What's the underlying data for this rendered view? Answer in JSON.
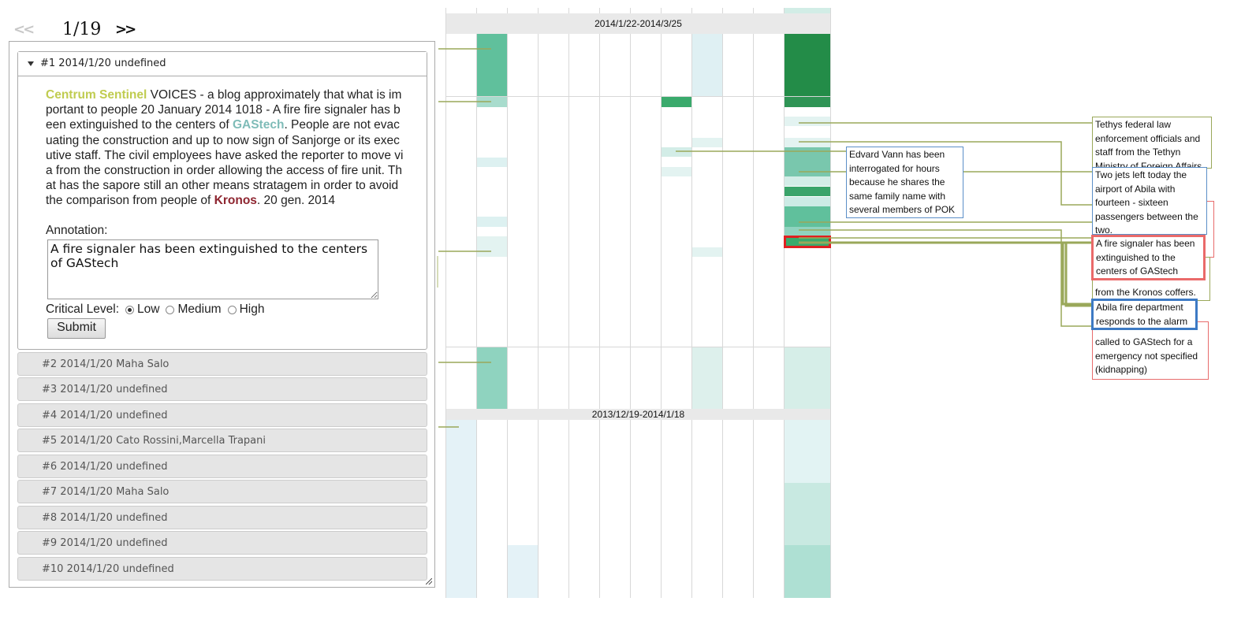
{
  "pager": {
    "prev_label": "<<",
    "text": "1/19",
    "next_label": ">>"
  },
  "current_article": {
    "header": "#1 2014/1/20 undefined",
    "source": "Centrum Sentinel",
    "text_1": " VOICES - a blog approximately that what is important to people 20 January 2014 1018 - A fire fire signaler has been extinguished to the centers of ",
    "entity_2": "GAStech",
    "text_2": ". People are not evacuating the construction and up to now sign of Sanjorge or its executive staff. The civil employees have asked the reporter to move via from the construction in order allowing the access of fire unit. That has the sapore still an other means stratagem in order to avoid the comparison from people of ",
    "entity_3": "Kronos",
    "text_3": ". 20 gen. 2014",
    "annotation_label": "Annotation:",
    "annotation_value": "A fire signaler has been extinguished to the centers of GAStech",
    "critical_label": "Critical Level:",
    "levels": [
      "Low",
      "Medium",
      "High"
    ],
    "selected_level": "Low",
    "submit_label": "Submit"
  },
  "articles": [
    "#2 2014/1/20 Maha Salo",
    "#3 2014/1/20 undefined",
    "#4 2014/1/20 undefined",
    "#5 2014/1/20 Cato Rossini,Marcella Trapani",
    "#6 2014/1/20 undefined",
    "#7 2014/1/20 Maha Salo",
    "#8 2014/1/20 undefined",
    "#9 2014/1/20 undefined",
    "#10 2014/1/20 undefined"
  ],
  "date_ranges": [
    "2014/1/22-2014/3/25",
    "2013/12/19-2014/1/18"
  ],
  "callouts": [
    "Tethys federal law enforcement officials and staff from the Tethyn Ministry of Foreign Affairs",
    "Two jets left today the airport of Abila with fourteen - sixteen passengers between the two.",
    "Edvard Vann has been interrogated for hours because he shares the same family name with several members of POK",
    "A fire signaler has been extinguished to the centers of GAStech",
    "from the Kronos coffers.",
    "Abila fire department responds to the alarm",
    "called to GAStech for a emergency not specified (kidnapping)"
  ],
  "colors": {
    "dark_green": "#238c48",
    "medium_green": "#3aaa6c",
    "teal": "#60c09c",
    "light_teal": "#8fd3bf",
    "pale": "#ccebe5",
    "very_pale": "#e0f2f2",
    "connector": "#9aa85a",
    "highlight_red": "#e02020"
  }
}
